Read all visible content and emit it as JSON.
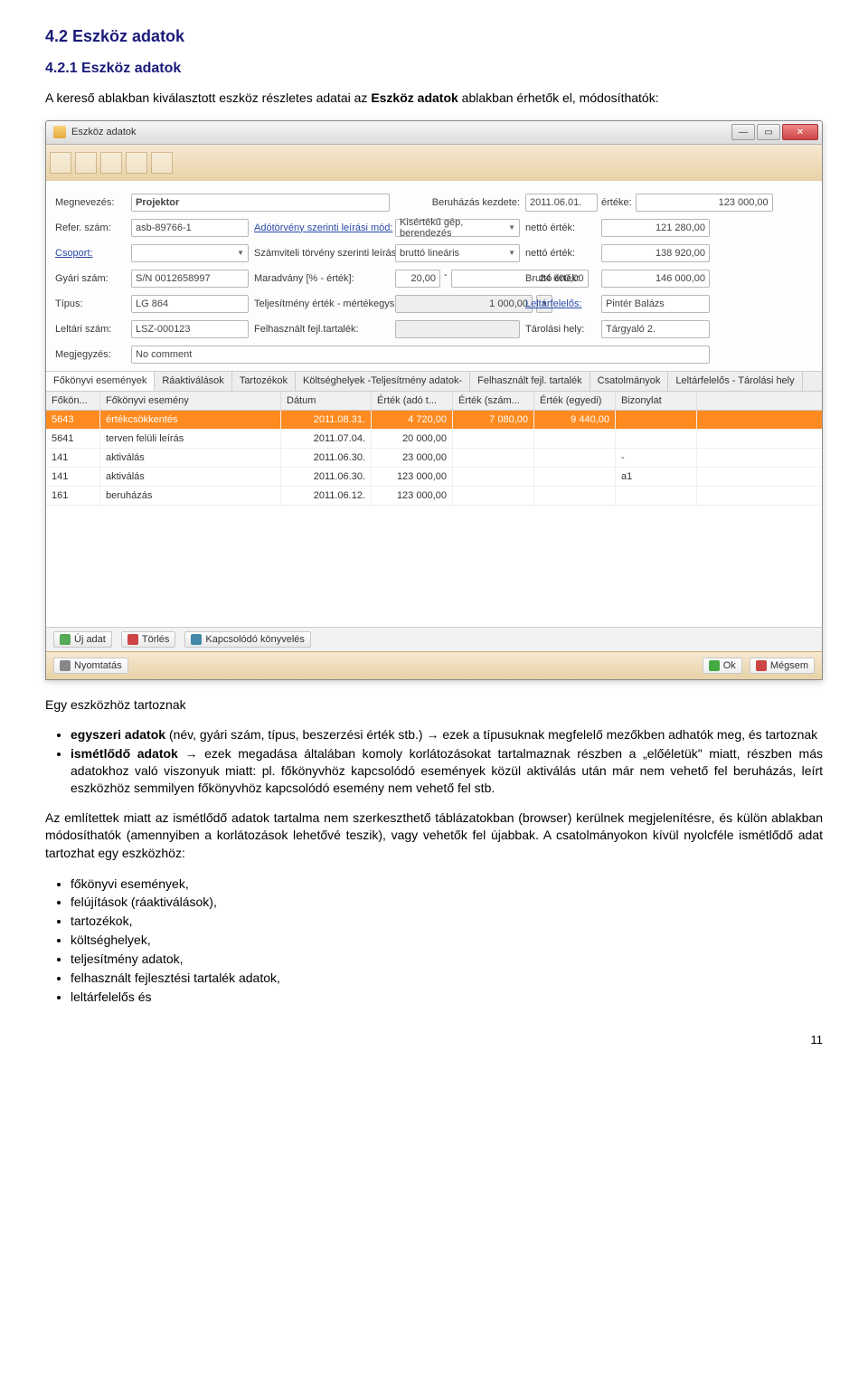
{
  "headings": {
    "h2": "4.2 Eszköz adatok",
    "h3": "4.2.1 Eszköz adatok"
  },
  "paragraphs": {
    "intro_1": "A kereső ablakban kiválasztott eszköz részletes adatai az ",
    "intro_bold": "Eszköz adatok",
    "intro_2": " ablakban érhetők el, módosíthatók:",
    "after_screenshot": "Egy eszközhöz tartoznak",
    "bullet1_part1": "egyszeri adatok",
    "bullet1_part2": " (név, gyári szám, típus, beszerzési érték stb.) → ezek a típusuknak megfelelő mezőkben adhatók meg, és tartoznak",
    "bullet2_part1": "ismétlődő adatok",
    "bullet2_part2": " → ezek megadása általában komoly korlátozásokat tartalmaznak részben a „előéletük\" miatt, részben  más adatokhoz való viszonyuk miatt: pl. főkönyvhöz kapcsolódó események közül aktiválás után már nem vehető fel beruházás, leírt eszközhöz semmilyen főkönyvhöz kapcsolódó esemény nem vehető fel stb.",
    "para3": "Az említettek miatt az ismétlődő adatok tartalma nem szerkeszthető táblázatokban (browser) kerülnek megjelenítésre, és külön ablakban módosíthatók (amennyiben a korlátozások lehetővé teszik), vagy vehetők fel újabbak. A csatolmányokon kívül nyolcféle ismétlődő adat tartozhat egy eszközhöz:",
    "list_items": [
      "főkönyvi események,",
      "felújítások (ráaktiválások),",
      "tartozékok,",
      "költséghelyek,",
      "teljesítmény adatok,",
      "felhasznált fejlesztési tartalék adatok,",
      "leltárfelelős és"
    ]
  },
  "window": {
    "title": "Eszköz adatok",
    "form": {
      "r1": {
        "l1": "Megnevezés:",
        "v1": "Projektor",
        "l2": "Beruházás kezdete:",
        "v2": "2011.06.01.",
        "l3": "értéke:",
        "v3": "123 000,00"
      },
      "r2": {
        "l1": "Refer. szám:",
        "v1": "asb-89766-1",
        "l2": "Adótörvény szerinti leírási mód:",
        "v2": "Kisértékű gép, berendezés",
        "l3": "nettó érték:",
        "v3": "121 280,00"
      },
      "r3": {
        "l1": "Csoport:",
        "v1": "",
        "l2": "Számviteli törvény szerinti leírási mód:",
        "v2": "bruttó lineáris",
        "l3": "nettó érték:",
        "v3": "138 920,00"
      },
      "r4": {
        "l1": "Gyári szám:",
        "v1": "S/N 0012658997",
        "l2": "Maradvány [% - érték]:",
        "v2a": "20,00",
        "v2b": "24 600,00",
        "l3": "Bruttó érték:",
        "v3": "146 000,00"
      },
      "r5": {
        "l1": "Típus:",
        "v1": "LG 864",
        "l2": "Teljesítmény érték - mértékegys.:",
        "v2": "1 000,00",
        "l3": "Leltárfelelős:",
        "v3": "Pintér Balázs"
      },
      "r6": {
        "l1": "Leltári szám:",
        "v1": "LSZ-000123",
        "l2": "Felhasznált fejl.tartalék:",
        "v2": "",
        "l3": "Tárolási hely:",
        "v3": "Tárgyaló 2."
      },
      "r7": {
        "l1": "Megjegyzés:",
        "v1": "No comment"
      }
    },
    "tabs": [
      "Főkönyvi események",
      "Ráaktiválások",
      "Tartozékok",
      "Költséghelyek -Teljesítmény adatok-",
      "Felhasznált fejl. tartalék",
      "Csatolmányok",
      "Leltárfelelős - Tárolási hely"
    ],
    "grid_headers": [
      "Főkön...",
      "Főkönyvi esemény",
      "Dátum",
      "Érték (adó t...",
      "Érték (szám...",
      "Érték (egyedi)",
      "Bizonylat"
    ],
    "grid_rows": [
      {
        "c0": "5643",
        "c1": "értékcsökkentés",
        "c2": "2011.08.31.",
        "c3": "4 720,00",
        "c4": "7 080,00",
        "c5": "9 440,00",
        "c6": "",
        "sel": true
      },
      {
        "c0": "5641",
        "c1": "terven felüli leírás",
        "c2": "2011.07.04.",
        "c3": "20 000,00",
        "c4": "",
        "c5": "",
        "c6": "",
        "sel": false
      },
      {
        "c0": "141",
        "c1": "aktiválás",
        "c2": "2011.06.30.",
        "c3": "23 000,00",
        "c4": "",
        "c5": "",
        "c6": "-",
        "sel": false
      },
      {
        "c0": "141",
        "c1": "aktiválás",
        "c2": "2011.06.30.",
        "c3": "123 000,00",
        "c4": "",
        "c5": "",
        "c6": "a1",
        "sel": false
      },
      {
        "c0": "161",
        "c1": "beruházás",
        "c2": "2011.06.12.",
        "c3": "123 000,00",
        "c4": "",
        "c5": "",
        "c6": "",
        "sel": false
      }
    ],
    "actions": {
      "add": "Új adat",
      "del": "Törlés",
      "link": "Kapcsolódó könyvelés"
    },
    "bottom": {
      "print": "Nyomtatás",
      "ok": "Ok",
      "cancel": "Mégsem"
    }
  },
  "page_number": "11"
}
